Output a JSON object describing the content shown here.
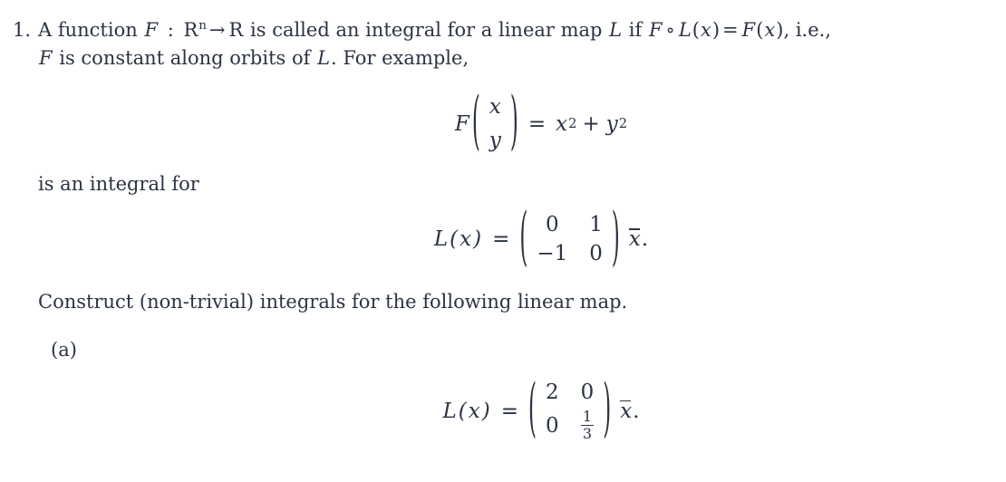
{
  "document": {
    "item_number": "1.",
    "sublabel": "(a)",
    "text_color": "#2b3442",
    "background_color": "#ffffff"
  },
  "paragraph1": {
    "seg_a": "A function ",
    "f": "F",
    "colon": " : ",
    "rn": "R",
    "rn_sup": "n",
    "arrow": "→",
    "r2": "R",
    "seg_b": " is called an integral for a linear map ",
    "l": "L",
    "seg_c": " if ",
    "f2": "F",
    "ring": "∘",
    "l2": "L",
    "open1": "(",
    "x1": "x",
    "close1": ")",
    "equals": "=",
    "f3": "F",
    "open2": "(",
    "x2": "x",
    "close2": ")",
    "seg_d": ", i.e.,"
  },
  "paragraph2": {
    "f": "F",
    "seg_a": " is constant along orbits of ",
    "l": "L",
    "seg_b": ". For example,"
  },
  "paragraph3": {
    "text": "is an integral for"
  },
  "paragraph4": {
    "text": "Construct (non-trivial) integrals for the following linear map."
  },
  "equation1": {
    "function_name": "F",
    "open_paren": "(",
    "close_paren": ")",
    "vector": [
      "x",
      "y"
    ],
    "equals": "=",
    "rhs_term1_base": "x",
    "rhs_term1_exp": "2",
    "plus": "+",
    "rhs_term2_base": "y",
    "rhs_term2_exp": "2"
  },
  "equation2": {
    "lhs_name": "L",
    "lhs_open": "(",
    "lhs_var": "x",
    "lhs_close": ")",
    "equals": "=",
    "open_paren": "(",
    "close_paren": ")",
    "matrix": [
      [
        "0",
        "1"
      ],
      [
        "−1",
        "0"
      ]
    ],
    "vector_var": "x",
    "period": "."
  },
  "equation3": {
    "lhs_name": "L",
    "lhs_open": "(",
    "lhs_var": "x",
    "lhs_close": ")",
    "equals": "=",
    "open_paren": "(",
    "close_paren": ")",
    "matrix_r0c0": "2",
    "matrix_r0c1": "0",
    "matrix_r1c0": "0",
    "matrix_r1c1_num": "1",
    "matrix_r1c1_den": "3",
    "vector_var": "x",
    "period": "."
  }
}
